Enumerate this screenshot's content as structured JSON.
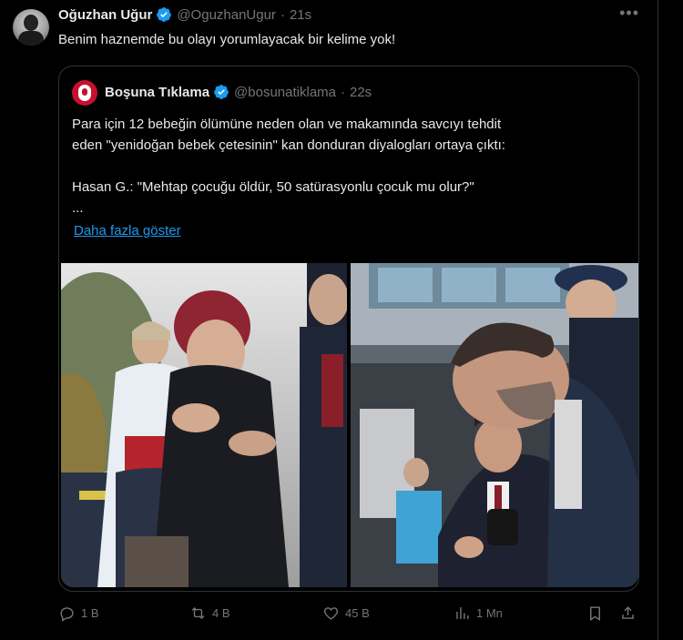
{
  "tweet": {
    "author_name": "Oğuzhan Uğur",
    "author_handle": "@OguzhanUgur",
    "separator": "·",
    "time": "21s",
    "text": "Benim haznemde bu olayı yorumlayacak bir kelime yok!",
    "more_label": "•••"
  },
  "quote": {
    "author_name": "Boşuna Tıklama",
    "author_handle": "@bosunatiklama",
    "separator": "·",
    "time": "22s",
    "line1": "Para için 12 bebeğin ölümüne neden olan ve makamında savcıyı tehdit",
    "line2": "eden \"yenidoğan bebek çetesinin\" kan donduran diyalogları ortaya çıktı:",
    "line3": "Hasan G.: \"Mehtap çocuğu öldür, 50 satürasyonlu çocuk mu olur?\"",
    "line4": "...",
    "show_more": "Daha fazla göster"
  },
  "actions": {
    "replies": "1 B",
    "reposts": "4 B",
    "likes": "45 B",
    "views": "1 Mn"
  },
  "colors": {
    "background": "#000000",
    "text": "#e7e9ea",
    "muted": "#71767b",
    "link": "#1d9bf0",
    "verified": "#1d9bf0",
    "brand_red": "#c8102e"
  },
  "icons": [
    "verified-badge-icon",
    "more-icon",
    "reply-icon",
    "repost-icon",
    "like-icon",
    "views-icon",
    "bookmark-icon",
    "share-icon"
  ]
}
